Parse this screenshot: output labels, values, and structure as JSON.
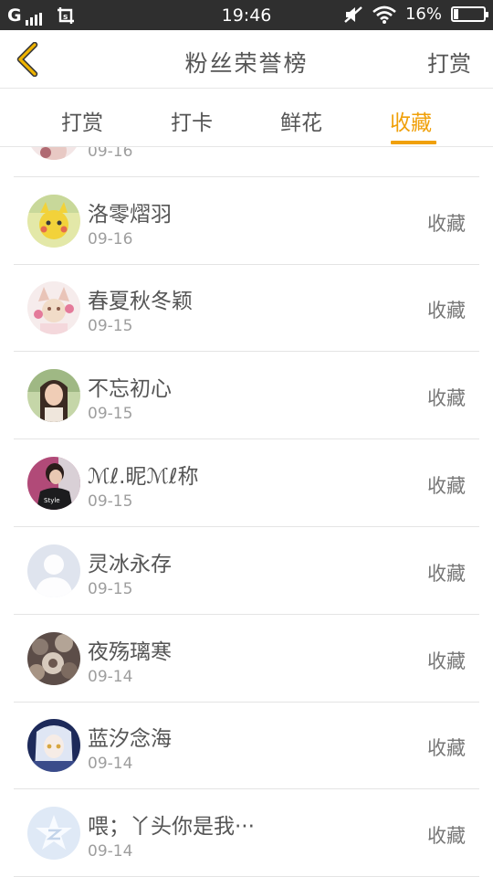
{
  "status_bar": {
    "signal": "G",
    "time": "19:46",
    "battery_percent": "16%",
    "battery_level": 0.16
  },
  "header": {
    "title": "粉丝荣誉榜",
    "right_action": "打赏"
  },
  "tabs": [
    {
      "label": "打赏",
      "active": false
    },
    {
      "label": "打卡",
      "active": false
    },
    {
      "label": "鲜花",
      "active": false
    },
    {
      "label": "收藏",
      "active": true
    }
  ],
  "list": {
    "partial_item": {
      "date": "09-16"
    },
    "items": [
      {
        "name": "洛零熠羽",
        "date": "09-16",
        "action": "收藏"
      },
      {
        "name": "春夏秋冬颖",
        "date": "09-15",
        "action": "收藏"
      },
      {
        "name": "不忘初心",
        "date": "09-15",
        "action": "收藏"
      },
      {
        "name": "ℳℓ.昵ℳℓ称",
        "date": "09-15",
        "action": "收藏"
      },
      {
        "name": "灵冰永存",
        "date": "09-15",
        "action": "收藏"
      },
      {
        "name": "夜殇璃寒",
        "date": "09-14",
        "action": "收藏"
      },
      {
        "name": "蓝汐念海",
        "date": "09-14",
        "action": "收藏"
      },
      {
        "name": "喂；丫头你是我···",
        "date": "09-14",
        "action": "收藏"
      }
    ]
  },
  "colors": {
    "accent": "#f0a00a",
    "status_bar_bg": "#2f2f2f",
    "divider": "#e4e4e4"
  }
}
